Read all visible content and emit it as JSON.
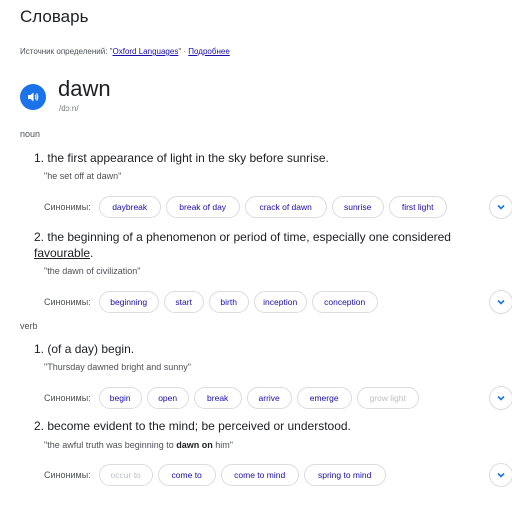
{
  "title": "Словарь",
  "source": {
    "prefix": "Источник определений: ",
    "quote_open": "\"",
    "name": "Oxford Languages",
    "quote_close": "\"",
    "sep": " · ",
    "more": "Подробнее"
  },
  "headword": {
    "word": "dawn",
    "phonetic": "/dɔːn/",
    "speaker_icon": "speaker-icon"
  },
  "synonyms_label": "Синонимы:",
  "parts": [
    {
      "pos": "noun",
      "senses": [
        {
          "num": "1.",
          "definition": "the first appearance of light in the sky before sunrise.",
          "example": "\"he set off at dawn\"",
          "synonyms": [
            "daybreak",
            "break of day",
            "crack of dawn",
            "sunrise",
            "first light"
          ]
        },
        {
          "num": "2.",
          "definition_a": "the beginning of a phenomenon or period of time, especially one considered",
          "definition_b": "favourable",
          "definition_c": ".",
          "example": "\"the dawn of civilization\"",
          "synonyms": [
            "beginning",
            "start",
            "birth",
            "inception",
            "conception"
          ]
        }
      ]
    },
    {
      "pos": "verb",
      "senses": [
        {
          "num": "1.",
          "definition": "(of a day) begin.",
          "example": "\"Thursday dawned bright and sunny\"",
          "synonyms": [
            "begin",
            "open",
            "break",
            "arrive",
            "emerge",
            "grow light"
          ]
        },
        {
          "num": "2.",
          "definition": "become evident to the mind; be perceived or understood.",
          "example_a": "\"the awful truth was beginning to ",
          "example_b": "dawn on",
          "example_c": " him\"",
          "synonyms": [
            "occur to",
            "come to",
            "come to mind",
            "spring to mind"
          ]
        }
      ]
    }
  ],
  "colors": {
    "link": "#1a0dab",
    "speaker_bg": "#1a73e8",
    "muted_chip": "#bdc1c6"
  }
}
